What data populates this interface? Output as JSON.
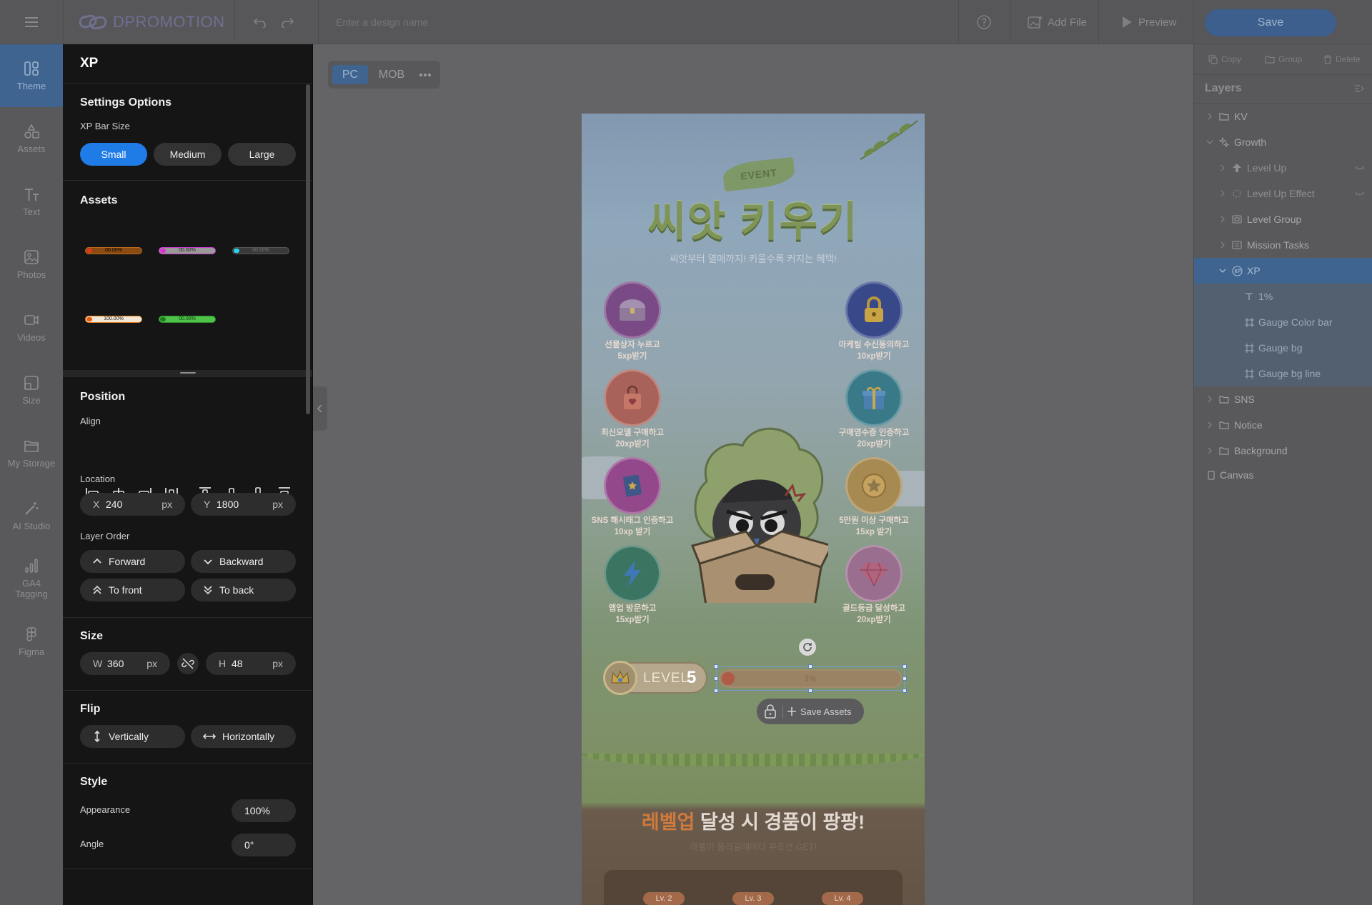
{
  "app": {
    "logo_text": "DPROMOTION",
    "design_name_placeholder": "Enter a design name",
    "add_file": "Add File",
    "preview": "Preview",
    "save": "Save"
  },
  "rail": {
    "items": [
      {
        "label": "Theme",
        "icon": "theme-icon"
      },
      {
        "label": "Assets",
        "icon": "assets-icon"
      },
      {
        "label": "Text",
        "icon": "text-icon"
      },
      {
        "label": "Photos",
        "icon": "photos-icon"
      },
      {
        "label": "Videos",
        "icon": "videos-icon"
      },
      {
        "label": "Size",
        "icon": "size-icon"
      },
      {
        "label": "My Storage",
        "icon": "folder-icon"
      },
      {
        "label": "AI Studio",
        "icon": "magic-wand-icon"
      },
      {
        "label": "GA4 Tagging",
        "icon": "analytics-icon"
      },
      {
        "label": "Figma",
        "icon": "figma-icon"
      }
    ]
  },
  "panel": {
    "title": "XP",
    "settings_heading": "Settings Options",
    "xp_bar_size_label": "XP Bar Size",
    "sizes": [
      "Small",
      "Medium",
      "Large"
    ],
    "selected_size": "Small",
    "assets_heading": "Assets",
    "asset_thumbs": [
      {
        "label": "00.00%",
        "color": "#d86a18"
      },
      {
        "label": "00.00%",
        "color": "#c030c8"
      },
      {
        "label": "00.00%",
        "color": "#20b8d8"
      },
      {
        "label": "100.00%",
        "color": "#e07a1e"
      },
      {
        "label": "00.00%",
        "color": "#3cb03c"
      }
    ],
    "position_heading": "Position",
    "align_label": "Align",
    "location_label": "Location",
    "x_label": "X",
    "x_value": "240",
    "x_unit": "px",
    "y_label": "Y",
    "y_value": "1800",
    "y_unit": "px",
    "layer_order_label": "Layer Order",
    "forward": "Forward",
    "backward": "Backward",
    "to_front": "To front",
    "to_back": "To back",
    "size_heading": "Size",
    "w_label": "W",
    "w_value": "360",
    "w_unit": "px",
    "h_label": "H",
    "h_value": "48",
    "h_unit": "px",
    "flip_heading": "Flip",
    "vertically": "Vertically",
    "horizontally": "Horizontally",
    "style_heading": "Style",
    "appearance_label": "Appearance",
    "appearance_value": "100%",
    "angle_label": "Angle",
    "angle_value": "0°"
  },
  "device_toggle": {
    "pc": "PC",
    "mob": "MOB",
    "active": "PC"
  },
  "canvas": {
    "event_tag": "EVENT",
    "title": "씨앗 키우기",
    "subtitle": "씨앗부터 열매까지! 키울수록 커지는 혜택!",
    "missions_left": [
      {
        "line1": "선물상자 누르고",
        "line2": "5xp받기",
        "color": "#8a4c94",
        "icon": "treasure-chest-icon"
      },
      {
        "line1": "최신모델 구매하고",
        "line2": "20xp받기",
        "color": "#b3675a",
        "icon": "shopping-bag-icon"
      },
      {
        "line1": "SNS 해시태그 인증하고",
        "line2": "10xp 받기",
        "color": "#9a4d8e",
        "icon": "book-icon"
      },
      {
        "line1": "앱업 방문하고",
        "line2": "15xp받기",
        "color": "#3f7e6a",
        "icon": "lightning-icon"
      }
    ],
    "missions_right": [
      {
        "line1": "마케팅 수신동의하고",
        "line2": "10xp받기",
        "color": "#3c4d8c",
        "icon": "lock-icon"
      },
      {
        "line1": "구매영수증 인증하고",
        "line2": "20xp받기",
        "color": "#3f8090",
        "icon": "gift-icon"
      },
      {
        "line1": "5만원 이상 구매하고",
        "line2": "15xp 받기",
        "color": "#a88950",
        "icon": "star-coin-icon"
      },
      {
        "line1": "골드등급 달성하고",
        "line2": "20xp받기",
        "color": "#9a6b8d",
        "icon": "gem-icon"
      }
    ],
    "level_label": "LEVEL",
    "level_number": "5",
    "xp_percent": "1%",
    "xp_progress": 0.01,
    "save_assets": "Save Assets",
    "reward_highlight": "레벨업",
    "reward_title": "달성 시 경품이 팡팡!",
    "reward_subtitle": "레벨이 올라갈때마다 무조건 GET!",
    "level_tabs": [
      "Lv. 2",
      "Lv. 3",
      "Lv. 4"
    ]
  },
  "layers_panel": {
    "copy": "Copy",
    "group": "Group",
    "delete": "Delete",
    "title": "Layers",
    "items": [
      {
        "label": "KV",
        "type": "folder"
      },
      {
        "label": "Growth",
        "type": "group"
      },
      {
        "label": "Level Up",
        "type": "shape"
      },
      {
        "label": "Level Up Effect",
        "type": "effect"
      },
      {
        "label": "Level Group",
        "type": "component"
      },
      {
        "label": "Mission Tasks",
        "type": "component"
      },
      {
        "label": "XP",
        "type": "xp"
      },
      {
        "label": "1%",
        "type": "text"
      },
      {
        "label": "Gauge Color bar",
        "type": "frame"
      },
      {
        "label": "Gauge bg",
        "type": "frame"
      },
      {
        "label": "Gauge bg line",
        "type": "frame"
      },
      {
        "label": "SNS",
        "type": "folder"
      },
      {
        "label": "Notice",
        "type": "folder"
      },
      {
        "label": "Background",
        "type": "folder"
      },
      {
        "label": "Canvas",
        "type": "canvas"
      }
    ],
    "selected": "XP"
  }
}
